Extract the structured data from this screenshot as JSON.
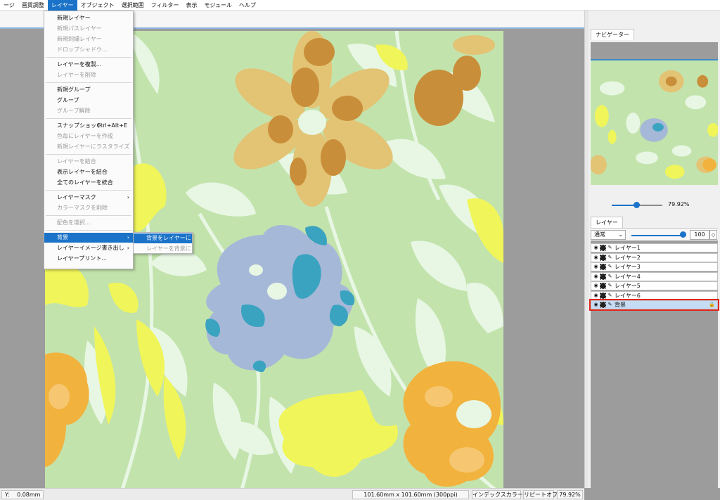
{
  "menubar": {
    "items": [
      "ージ",
      "画質調整",
      "レイヤー",
      "オブジェクト",
      "選択範囲",
      "フィルター",
      "表示",
      "モジュール",
      "ヘルプ"
    ],
    "active_index": 2
  },
  "layer_menu": {
    "items": [
      {
        "label": "新規レイヤー",
        "disabled": false
      },
      {
        "label": "新規パスレイヤー",
        "disabled": true
      },
      {
        "label": "新規刺繍レイヤー",
        "disabled": true
      },
      {
        "label": "ドロップシャドウ...",
        "disabled": true
      },
      {
        "label": "レイヤーを複製...",
        "disabled": false
      },
      {
        "label": "レイヤーを削除",
        "disabled": true
      },
      {
        "label": "新規グループ",
        "disabled": false
      },
      {
        "label": "グループ",
        "disabled": false
      },
      {
        "label": "グループ解除",
        "disabled": true
      },
      {
        "label": "スナップショット",
        "disabled": false,
        "shortcut": "Ctrl+Alt+E"
      },
      {
        "label": "色毎にレイヤーを作成",
        "disabled": true
      },
      {
        "label": "新規レイヤーにラスタライズ",
        "disabled": true
      },
      {
        "label": "レイヤーを結合",
        "disabled": true
      },
      {
        "label": "表示レイヤーを結合",
        "disabled": false
      },
      {
        "label": "全てのレイヤーを統合",
        "disabled": false
      },
      {
        "label": "レイヤーマスク",
        "disabled": false,
        "submenu": true
      },
      {
        "label": "カラーマスクを削除",
        "disabled": true
      },
      {
        "label": "配色を選択...",
        "disabled": true
      },
      {
        "label": "背景",
        "disabled": false,
        "submenu": true,
        "highlighted": true
      },
      {
        "label": "レイヤーイメージ書き出し",
        "disabled": false,
        "submenu": true
      },
      {
        "label": "レイヤープリント...",
        "disabled": false
      }
    ]
  },
  "background_submenu": {
    "items": [
      {
        "label": "背景をレイヤーに",
        "highlighted": true,
        "disabled": false
      },
      {
        "label": "レイヤーを背景に",
        "highlighted": false,
        "disabled": true
      }
    ]
  },
  "navigator": {
    "tab_label": "ナビゲーター",
    "zoom": "79.92%"
  },
  "layers_panel": {
    "tab_label": "レイヤー",
    "blend_mode": "通常",
    "opacity": "100",
    "layers": [
      "レイヤー1",
      "レイヤー2",
      "レイヤー3",
      "レイヤー4",
      "レイヤー5",
      "レイヤー6",
      "背景"
    ],
    "selected_layer": "背景"
  },
  "statusbar": {
    "y_label": "Y:",
    "y_value": "0.08mm",
    "document_size": "101.60mm x 101.60mm (300ppi)",
    "color_mode": "インデックスカラー",
    "repeat": "リピートオフ",
    "zoom": "79.92%"
  },
  "colors": {
    "accent": "#1a73c8",
    "selection_outline": "#e0281e",
    "canvas_bg": "#9c9c9c",
    "fabric_green": "#c3e3ad",
    "leaf_pale": "#e8f7e4",
    "flower_tan": "#e3c374",
    "flower_brown": "#c98e39",
    "flower_blue": "#a6b8d8",
    "flower_teal": "#3aa3c0",
    "flower_yellow": "#f0f55a",
    "flower_orange": "#f2b23e"
  },
  "icons": {
    "eye": "eye-icon",
    "lock": "lock-icon",
    "pen": "pen-icon",
    "submenu": "chevron-right-icon"
  }
}
